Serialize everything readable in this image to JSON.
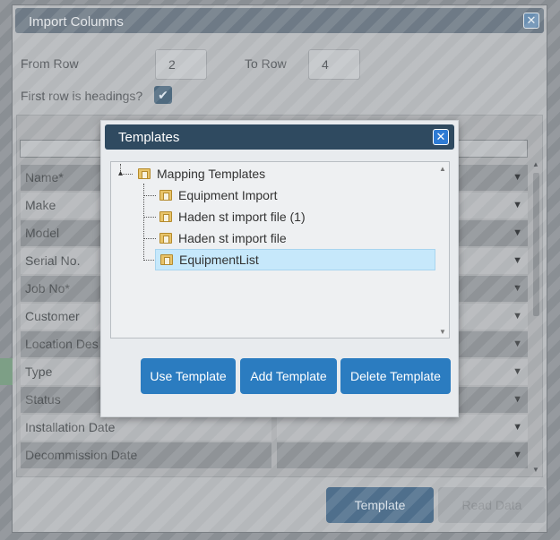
{
  "import_dialog": {
    "title": "Import Columns",
    "from_row_label": "From Row",
    "from_row_value": "2",
    "to_row_label": "To Row",
    "to_row_value": "4",
    "first_row_headings_label": "First row is headings?",
    "first_row_headings_checked": true,
    "rows": [
      {
        "name": "Name*"
      },
      {
        "name": "Make"
      },
      {
        "name": "Model"
      },
      {
        "name": "Serial No."
      },
      {
        "name": "Job No*"
      },
      {
        "name": "Customer"
      },
      {
        "name": "Location Des"
      },
      {
        "name": "Type"
      },
      {
        "name": "Status"
      },
      {
        "name": "Installation Date"
      },
      {
        "name": "Decommission Date"
      }
    ],
    "template_button": "Template",
    "read_data_button": "Read Data"
  },
  "templates_modal": {
    "title": "Templates",
    "tree": {
      "root": "Mapping Templates",
      "children": [
        "Equipment Import",
        "Haden st import file (1)",
        "Haden st import file",
        "EquipmentList"
      ],
      "selected": "EquipmentList"
    },
    "buttons": {
      "use": "Use Template",
      "add": "Add Template",
      "delete": "Delete Template"
    }
  },
  "icons": {
    "close": "close-icon",
    "checkbox": "checkmark-icon",
    "folder": "folder-icon",
    "dropdown": "chevron-down-icon"
  },
  "colors": {
    "modal_titlebar": "#2f4a60",
    "button_blue": "#2b7cc0",
    "selected_node": "#c6e8fb"
  }
}
